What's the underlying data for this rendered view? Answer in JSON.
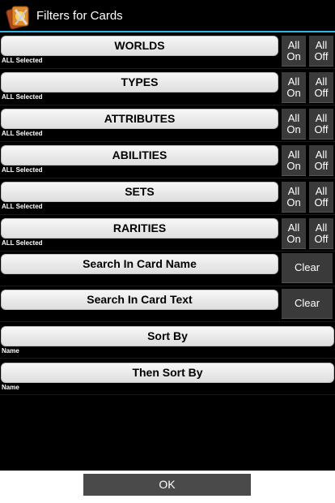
{
  "titlebar": {
    "title": "Filters for Cards",
    "icon": "card-app-icon"
  },
  "filters": [
    {
      "label": "WORLDS",
      "status": "ALL Selected",
      "all_on": "All\nOn",
      "all_off": "All\nOff"
    },
    {
      "label": "TYPES",
      "status": "ALL Selected",
      "all_on": "All\nOn",
      "all_off": "All\nOff"
    },
    {
      "label": "ATTRIBUTES",
      "status": "ALL Selected",
      "all_on": "All\nOn",
      "all_off": "All\nOff"
    },
    {
      "label": "ABILITIES",
      "status": "ALL Selected",
      "all_on": "All\nOn",
      "all_off": "All\nOff"
    },
    {
      "label": "SETS",
      "status": "ALL Selected",
      "all_on": "All\nOn",
      "all_off": "All\nOff"
    },
    {
      "label": "RARITIES",
      "status": "ALL Selected",
      "all_on": "All\nOn",
      "all_off": "All\nOff"
    }
  ],
  "search": [
    {
      "label": "Search In Card Name",
      "clear": "Clear"
    },
    {
      "label": "Search In Card Text",
      "clear": "Clear"
    }
  ],
  "sort": [
    {
      "label": "Sort By",
      "value": "Name"
    },
    {
      "label": "Then Sort By",
      "value": "Name"
    }
  ],
  "footer": {
    "ok_label": "OK"
  },
  "colors": {
    "accent": "#33b5e5",
    "background": "#000000",
    "button_dark": "#3a3a3a"
  }
}
